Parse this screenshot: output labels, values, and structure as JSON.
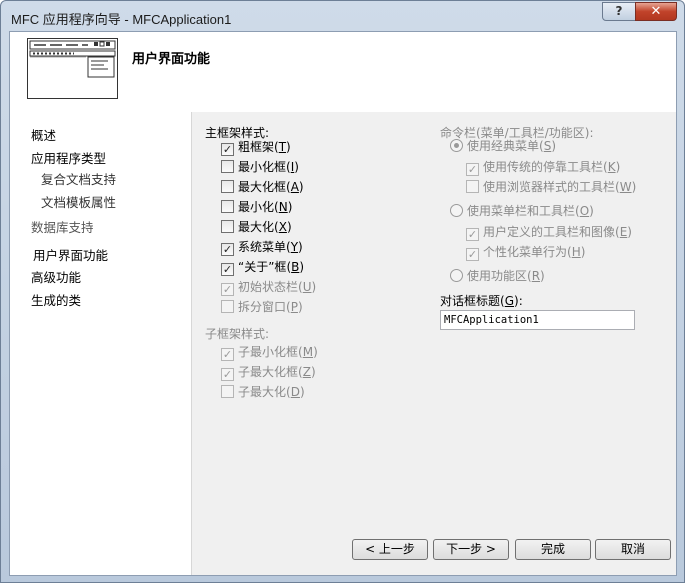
{
  "window": {
    "title": "MFC 应用程序向导 - MFCApplication1",
    "help_label": "?",
    "close_label": "✕"
  },
  "header": {
    "title": "用户界面功能"
  },
  "sidebar": {
    "items": [
      {
        "label": "概述"
      },
      {
        "label": "应用程序类型"
      },
      {
        "label": "复合文档支持"
      },
      {
        "label": "文档模板属性"
      },
      {
        "label": "数据库支持"
      },
      {
        "label": "用户界面功能"
      },
      {
        "label": "高级功能"
      },
      {
        "label": "生成的类"
      }
    ]
  },
  "main_frame": {
    "title": "主框架样式:",
    "options": [
      {
        "label": "粗框架",
        "key": "T",
        "checked": true,
        "enabled": true
      },
      {
        "label": "最小化框",
        "key": "I",
        "checked": false,
        "enabled": true
      },
      {
        "label": "最大化框",
        "key": "A",
        "checked": false,
        "enabled": true
      },
      {
        "label": "最小化",
        "key": "N",
        "checked": false,
        "enabled": true
      },
      {
        "label": "最大化",
        "key": "X",
        "checked": false,
        "enabled": true
      },
      {
        "label": "系统菜单",
        "key": "Y",
        "checked": true,
        "enabled": true
      },
      {
        "label": "“关于”框",
        "key": "B",
        "checked": true,
        "enabled": true
      },
      {
        "label": "初始状态栏",
        "key": "U",
        "checked": true,
        "enabled": false
      },
      {
        "label": "拆分窗口",
        "key": "P",
        "checked": false,
        "enabled": false
      }
    ]
  },
  "child_frame": {
    "title": "子框架样式:",
    "options": [
      {
        "label": "子最小化框",
        "key": "M",
        "checked": true,
        "enabled": false
      },
      {
        "label": "子最大化框",
        "key": "Z",
        "checked": true,
        "enabled": false
      },
      {
        "label": "子最大化",
        "key": "D",
        "checked": false,
        "enabled": false
      }
    ]
  },
  "command_bar": {
    "title": "命令栏(菜单/工具栏/功能区):",
    "classic": {
      "label": "使用经典菜单",
      "key": "S",
      "selected": true
    },
    "classic_children": [
      {
        "label": "使用传统的停靠工具栏",
        "key": "K",
        "checked": true
      },
      {
        "label": "使用浏览器样式的工具栏",
        "key": "W",
        "checked": false
      }
    ],
    "menubar": {
      "label": "使用菜单栏和工具栏",
      "key": "O",
      "selected": false
    },
    "menubar_children": [
      {
        "label": "用户定义的工具栏和图像",
        "key": "E",
        "checked": true
      },
      {
        "label": "个性化菜单行为",
        "key": "H",
        "checked": true
      }
    ],
    "ribbon": {
      "label": "使用功能区",
      "key": "R",
      "selected": false
    }
  },
  "dialog_caption": {
    "label": "对话框标题",
    "key": "G",
    "value": "MFCApplication1"
  },
  "buttons": {
    "prev": "< 上一步",
    "next": "下一步 >",
    "finish": "完成",
    "cancel": "取消"
  }
}
